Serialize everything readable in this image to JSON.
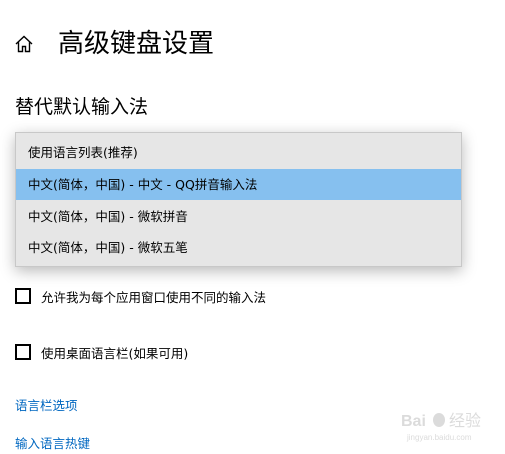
{
  "header": {
    "home_icon": "home-icon",
    "title": "高级键盘设置"
  },
  "override": {
    "section_title": "替代默认输入法",
    "options": [
      "使用语言列表(推荐)",
      "中文(简体，中国) - 中文 - QQ拼音输入法",
      "中文(简体，中国) - 微软拼音",
      "中文(简体，中国) - 微软五笔"
    ],
    "selected_index": 1
  },
  "checkboxes": [
    {
      "label": "允许我为每个应用窗口使用不同的输入法",
      "checked": false
    },
    {
      "label": "使用桌面语言栏(如果可用)",
      "checked": false
    }
  ],
  "links": {
    "language_bar_options": "语言栏选项",
    "input_language_hotkeys": "输入语言热键"
  },
  "colors": {
    "accent_link": "#0067c0",
    "selection": "#86c0ef",
    "dropdown_bg": "#e6e6e6"
  },
  "watermark_text": "Baidu 经验 jingyan.baidu.com"
}
